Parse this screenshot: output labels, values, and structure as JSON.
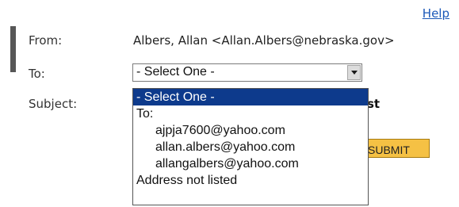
{
  "help": {
    "label": "Help"
  },
  "form": {
    "from_label": "From:",
    "from_value": "Albers, Allan <Allan.Albers@nebraska.gov>",
    "to_label": "To:",
    "subject_label": "Subject:",
    "subject_visible_tail": "st",
    "to_select": {
      "selected": "- Select One -",
      "options": [
        "- Select One -",
        "To:",
        "ajpja7600@yahoo.com",
        "allan.albers@yahoo.com",
        "allangalbers@yahoo.com",
        "Address not listed"
      ]
    },
    "submit_label": "SUBMIT"
  },
  "colors": {
    "link": "#1b58b8",
    "selection_highlight": "#0d3a8c",
    "submit_bg": "#f5c144"
  },
  "icons": {
    "select_arrow": "chevron-down-icon"
  }
}
